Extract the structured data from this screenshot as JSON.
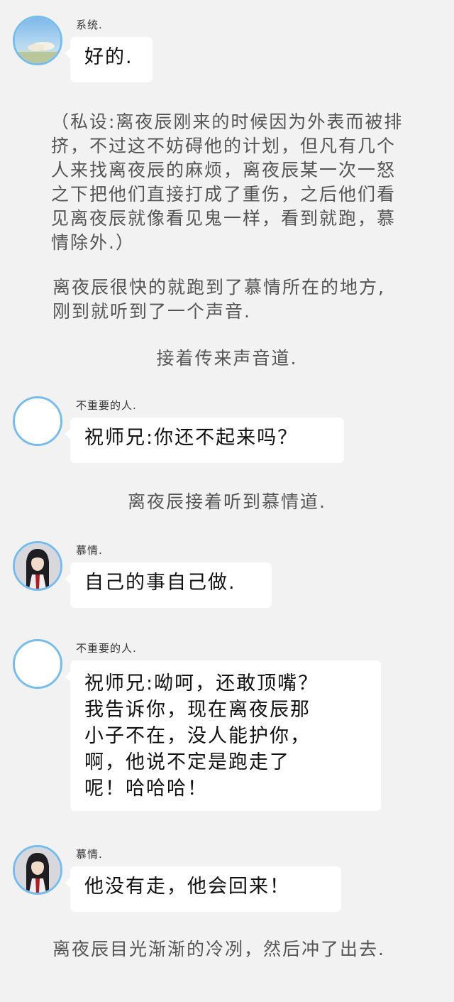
{
  "messages": [
    {
      "sender": "系统.",
      "text": "好的."
    },
    {
      "sender": "不重要的人.",
      "text": "祝师兄:你还不起来吗？"
    },
    {
      "sender": "慕情.",
      "text": "自己的事自己做."
    },
    {
      "sender": "不重要的人.",
      "text": "祝师兄:呦呵，还敢顶嘴？\n我告诉你，现在离夜辰那\n小子不在，没人能护你，\n啊，他说不定是跑走了\n呢！哈哈哈！"
    },
    {
      "sender": "慕情.",
      "text": "他没有走，他会回来！"
    }
  ],
  "narration": {
    "aside": "（私设:离夜辰刚来的时候因为外表而被排挤，不过这不妨碍他的计划，但凡有几个人来找离夜辰的麻烦，离夜辰某一次一怒之下把他们直接打成了重伤，之后他们看见离夜辰就像看见鬼一样，看到就跑，慕情除外.）",
    "paragraph_1": "离夜辰很快的就跑到了慕情所在的地方,刚到就听到了一个声音.",
    "line_1": "接着传来声音道.",
    "line_2": "离夜辰接着听到慕情道.",
    "paragraph_2": "离夜辰目光渐渐的冷冽，然后冲了出去."
  },
  "avatars": {
    "system": "sky-landscape-avatar",
    "unimportant": "blank-avatar",
    "muqing": "dark-haired-character-avatar"
  },
  "colors": {
    "background": "#f2f2f2",
    "bubble": "#ffffff",
    "avatar_ring": "#75bdf0"
  }
}
